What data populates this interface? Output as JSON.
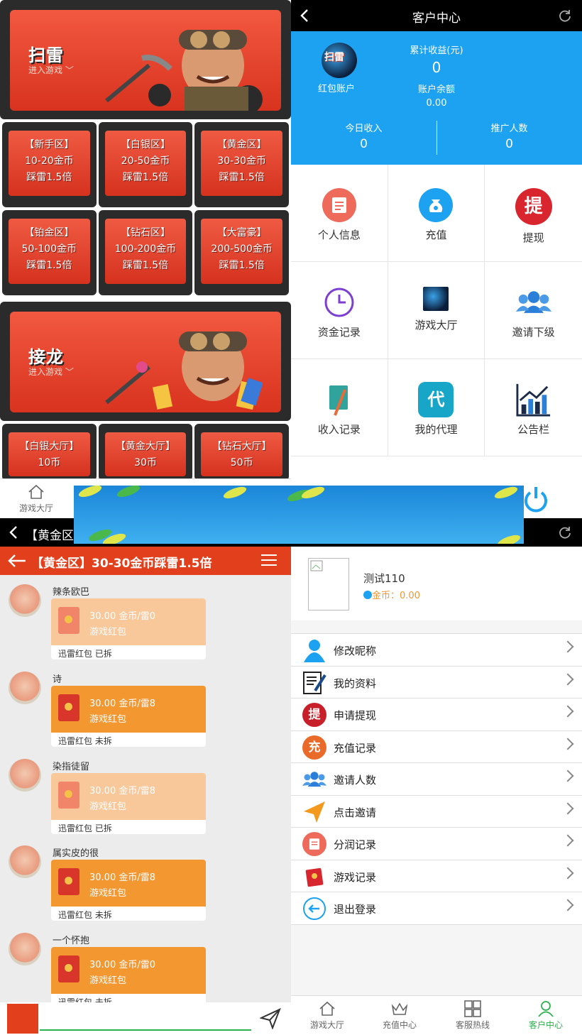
{
  "lobby": {
    "banner1": {
      "title": "扫雷",
      "sub": "进入游戏 ﹀"
    },
    "rooms": [
      [
        "【新手区】",
        "10-20金币",
        "踩雷1.5倍"
      ],
      [
        "【白银区】",
        "20-50金币",
        "踩雷1.5倍"
      ],
      [
        "【黄金区】",
        "30-30金币",
        "踩雷1.5倍"
      ],
      [
        "【铂金区】",
        "50-100金币",
        "踩雷1.5倍"
      ],
      [
        "【钻石区】",
        "100-200金币",
        "踩雷1.5倍"
      ],
      [
        "【大富豪】",
        "200-500金币",
        "踩雷1.5倍"
      ]
    ],
    "banner2": {
      "title": "接龙",
      "sub": "进入游戏 ﹀"
    },
    "halls": [
      [
        "【白银大厅】",
        "10币"
      ],
      [
        "【黄金大厅】",
        "30币"
      ],
      [
        "【钻石大厅】",
        "50币"
      ]
    ],
    "tab_label": "游戏大厅"
  },
  "center": {
    "title": "客户中心",
    "avatar_text": "扫雷",
    "account_label": "红包账户",
    "total_income_label": "累计收益(元)",
    "total_income": "0",
    "balance_label": "账户余额",
    "balance": "0.00",
    "today_label": "今日收入",
    "today": "0",
    "promo_label": "推广人数",
    "promo": "0",
    "grid": [
      "个人信息",
      "充值",
      "提现",
      "资金记录",
      "游戏大厅",
      "邀请下级",
      "收入记录",
      "我的代理",
      "公告栏"
    ],
    "tixian_char": "提",
    "dai_char": "代"
  },
  "chat": {
    "top_title": "【黄金区",
    "bar_title": "【黄金区】30-30金币踩雷1.5倍",
    "messages": [
      {
        "name": "辣条欧巴",
        "l1": "30.00 金币/雷0",
        "l2": "游戏红包",
        "foot": "迅雷红包 已拆",
        "opened": true
      },
      {
        "name": "诗",
        "l1": "30.00 金币/雷8",
        "l2": "游戏红包",
        "foot": "迅雷红包 未拆",
        "opened": false
      },
      {
        "name": "染指徒留",
        "l1": "30.00 金币/雷8",
        "l2": "游戏红包",
        "foot": "迅雷红包 已拆",
        "opened": true
      },
      {
        "name": "属实皮的很",
        "l1": "30.00 金币/雷8",
        "l2": "游戏红包",
        "foot": "迅雷红包 未拆",
        "opened": false
      },
      {
        "name": "一个怀抱",
        "l1": "30.00 金币/雷0",
        "l2": "游戏红包",
        "foot": "迅雷红包 未拆",
        "opened": false
      }
    ]
  },
  "profile": {
    "username": "测试110",
    "coin_label": "金币：",
    "coin": "0.00",
    "menu": [
      "修改昵称",
      "我的资料",
      "申请提现",
      "充值记录",
      "邀请人数",
      "点击邀请",
      "分润记录",
      "游戏记录",
      "退出登录"
    ],
    "ti_char": "提",
    "chong_char": "充",
    "tabs": [
      "游戏大厅",
      "充值中心",
      "客服热线",
      "客户中心"
    ]
  },
  "colors": {
    "accent_blue": "#1ca2f0",
    "red": "#e2401c",
    "green_active": "#2bb24c"
  }
}
